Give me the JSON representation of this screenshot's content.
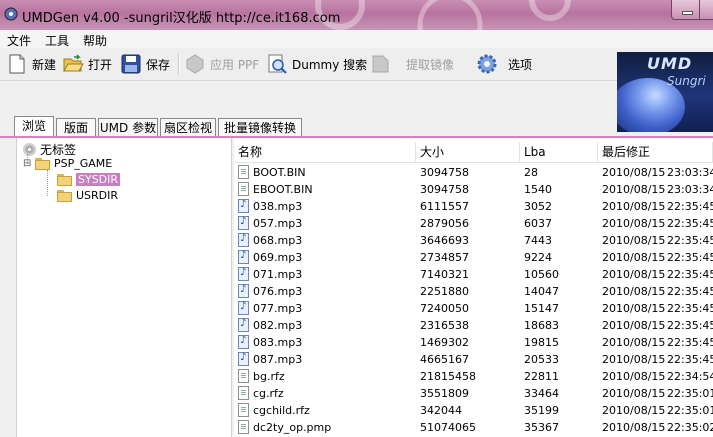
{
  "window": {
    "title": "UMDGen v4.00 -sungril汉化版  http://ce.it168.com"
  },
  "menu": {
    "items": [
      "文件",
      "工具",
      "帮助"
    ]
  },
  "toolbar": {
    "new_label": "新建",
    "open_label": "打开",
    "save_label": "保存",
    "apply_ppf_label": "应用 PPF",
    "dummy_search_label": "Dummy 搜索",
    "extract_image_label": "提取镜像",
    "options_label": "选项"
  },
  "banner": {
    "title": "UMD",
    "subtitle": "Sungri"
  },
  "tabs": [
    "浏览",
    "版面",
    "UMD 参数",
    "扇区检视",
    "批量镜像转换"
  ],
  "tree": {
    "root_label": "无标签",
    "nodes": [
      "PSP_GAME",
      "SYSDIR",
      "USRDIR"
    ],
    "selected": "SYSDIR"
  },
  "file_list": {
    "columns": [
      "名称",
      "大小",
      "Lba",
      "最后修正"
    ],
    "rows": [
      {
        "name": "BOOT.BIN",
        "size": "3094758",
        "lba": "28",
        "date": "2010/08/15",
        "time": "23:03:34",
        "type": "doc"
      },
      {
        "name": "EBOOT.BIN",
        "size": "3094758",
        "lba": "1540",
        "date": "2010/08/15",
        "time": "23:03:34",
        "type": "doc"
      },
      {
        "name": "038.mp3",
        "size": "6111557",
        "lba": "3052",
        "date": "2010/08/15",
        "time": "22:35:45",
        "type": "mp3"
      },
      {
        "name": "057.mp3",
        "size": "2879056",
        "lba": "6037",
        "date": "2010/08/15",
        "time": "22:35:45",
        "type": "mp3"
      },
      {
        "name": "068.mp3",
        "size": "3646693",
        "lba": "7443",
        "date": "2010/08/15",
        "time": "22:35:45",
        "type": "mp3"
      },
      {
        "name": "069.mp3",
        "size": "2734857",
        "lba": "9224",
        "date": "2010/08/15",
        "time": "22:35:45",
        "type": "mp3"
      },
      {
        "name": "071.mp3",
        "size": "7140321",
        "lba": "10560",
        "date": "2010/08/15",
        "time": "22:35:45",
        "type": "mp3"
      },
      {
        "name": "076.mp3",
        "size": "2251880",
        "lba": "14047",
        "date": "2010/08/15",
        "time": "22:35:45",
        "type": "mp3"
      },
      {
        "name": "077.mp3",
        "size": "7240050",
        "lba": "15147",
        "date": "2010/08/15",
        "time": "22:35:45",
        "type": "mp3"
      },
      {
        "name": "082.mp3",
        "size": "2316538",
        "lba": "18683",
        "date": "2010/08/15",
        "time": "22:35:45",
        "type": "mp3"
      },
      {
        "name": "083.mp3",
        "size": "1469302",
        "lba": "19815",
        "date": "2010/08/15",
        "time": "22:35:45",
        "type": "mp3"
      },
      {
        "name": "087.mp3",
        "size": "4665167",
        "lba": "20533",
        "date": "2010/08/15",
        "time": "22:35:45",
        "type": "mp3"
      },
      {
        "name": "bg.rfz",
        "size": "21815458",
        "lba": "22811",
        "date": "2010/08/15",
        "time": "22:34:54",
        "type": "doc"
      },
      {
        "name": "cg.rfz",
        "size": "3551809",
        "lba": "33464",
        "date": "2010/08/15",
        "time": "22:35:01",
        "type": "doc"
      },
      {
        "name": "cgchild.rfz",
        "size": "342044",
        "lba": "35199",
        "date": "2010/08/15",
        "time": "22:35:01",
        "type": "doc"
      },
      {
        "name": "dc2ty_op.pmp",
        "size": "51074065",
        "lba": "35367",
        "date": "2010/08/15",
        "time": "22:35:02",
        "type": "doc"
      }
    ]
  }
}
